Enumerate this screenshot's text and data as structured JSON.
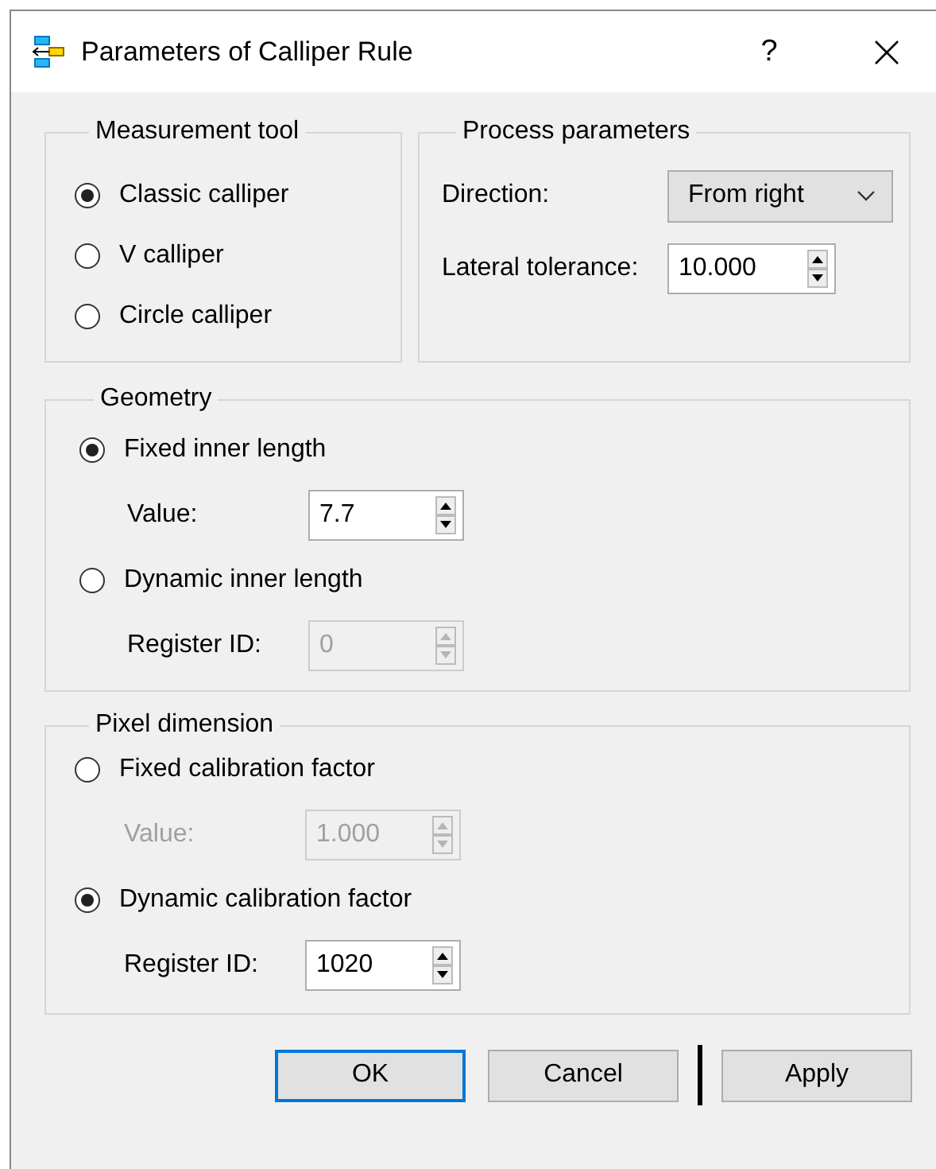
{
  "window": {
    "title": "Parameters of Calliper Rule",
    "help": "?"
  },
  "measurement_tool": {
    "title": "Measurement tool",
    "options": [
      {
        "label": "Classic calliper",
        "selected": true
      },
      {
        "label": "V calliper",
        "selected": false
      },
      {
        "label": "Circle calliper",
        "selected": false
      }
    ]
  },
  "process_parameters": {
    "title": "Process parameters",
    "direction": {
      "label": "Direction:",
      "value": "From right"
    },
    "lateral_tolerance": {
      "label": "Lateral tolerance:",
      "value": "10.000"
    }
  },
  "geometry": {
    "title": "Geometry",
    "options": [
      {
        "label": "Fixed inner length",
        "selected": true,
        "field": {
          "label": "Value:",
          "value": "7.7",
          "label_disabled": false,
          "disabled": false
        }
      },
      {
        "label": "Dynamic inner length",
        "selected": false,
        "field": {
          "label": "Register ID:",
          "value": "0",
          "label_disabled": false,
          "disabled": true
        }
      }
    ]
  },
  "pixel_dimension": {
    "title": "Pixel dimension",
    "options": [
      {
        "label": "Fixed calibration factor",
        "selected": false,
        "field": {
          "label": "Value:",
          "value": "1.000",
          "label_disabled": true,
          "disabled": true
        }
      },
      {
        "label": "Dynamic calibration factor",
        "selected": true,
        "field": {
          "label": "Register ID:",
          "value": "1020",
          "label_disabled": false,
          "disabled": false
        }
      }
    ]
  },
  "buttons": [
    {
      "label": "OK",
      "default": true
    },
    {
      "label": "Cancel",
      "default": false
    },
    {
      "label": "Apply",
      "default": false
    }
  ]
}
